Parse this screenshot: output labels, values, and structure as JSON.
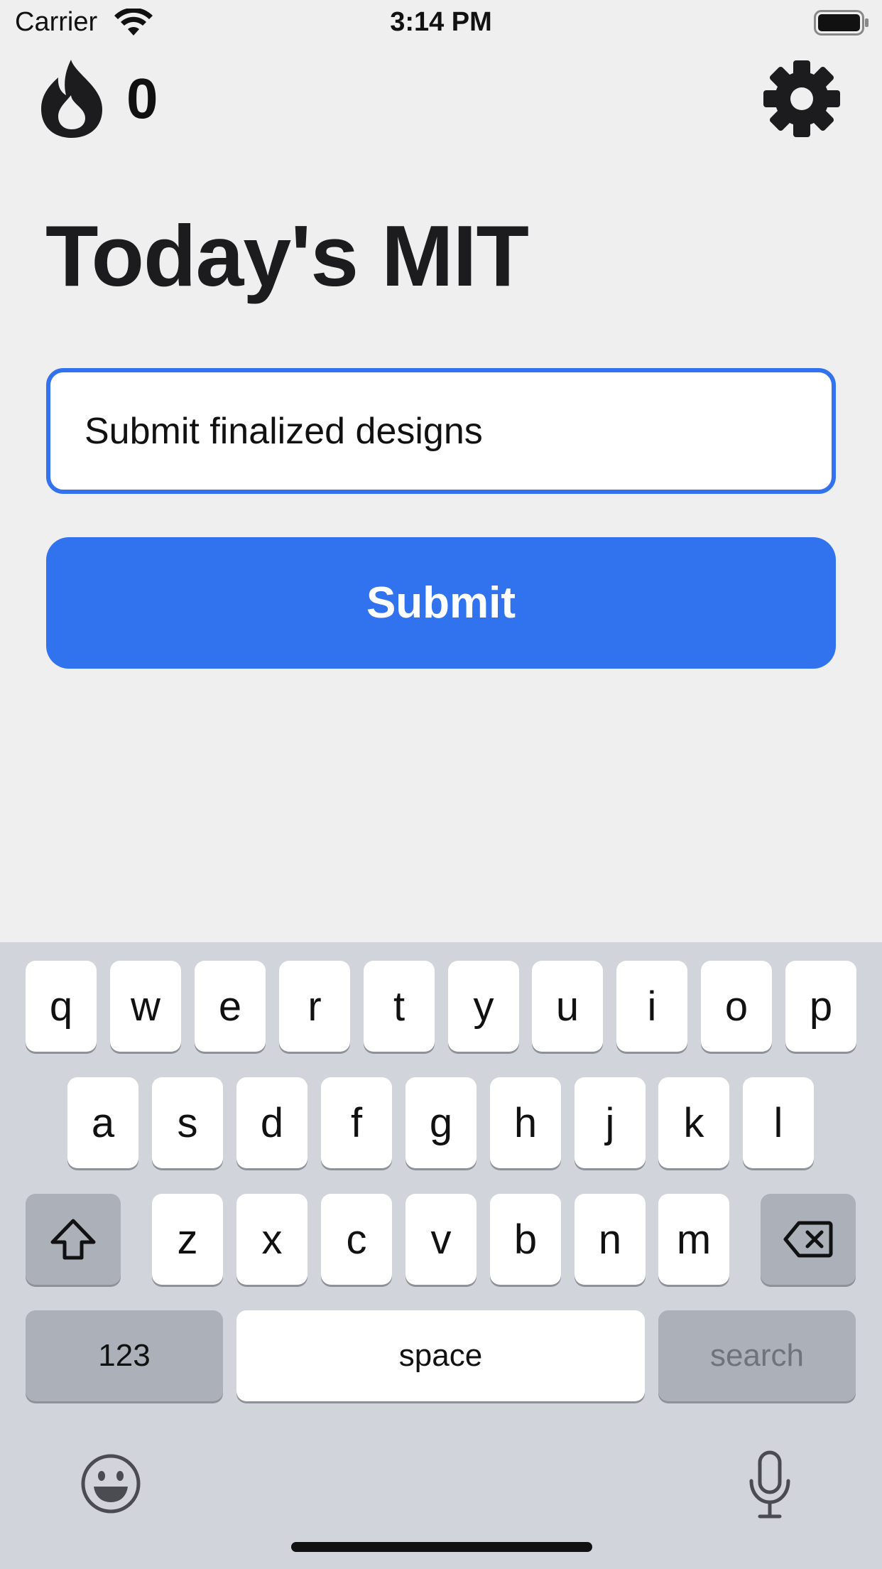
{
  "status_bar": {
    "carrier": "Carrier",
    "time": "3:14 PM",
    "wifi_icon": "wifi-icon",
    "battery_icon": "battery-icon"
  },
  "header": {
    "streak_icon": "flame-icon",
    "streak_count": "0",
    "settings_icon": "gear-icon"
  },
  "main": {
    "title": "Today's MIT",
    "mit_input": {
      "value": "Submit finalized designs",
      "placeholder": ""
    },
    "submit_label": "Submit"
  },
  "keyboard": {
    "row1": [
      "q",
      "w",
      "e",
      "r",
      "t",
      "y",
      "u",
      "i",
      "o",
      "p"
    ],
    "row2": [
      "a",
      "s",
      "d",
      "f",
      "g",
      "h",
      "j",
      "k",
      "l"
    ],
    "row3": [
      "z",
      "x",
      "c",
      "v",
      "b",
      "n",
      "m"
    ],
    "numbers_label": "123",
    "space_label": "space",
    "return_label": "search",
    "icons": [
      "shift-icon",
      "delete-icon",
      "emoji-icon",
      "microphone-icon"
    ]
  },
  "colors": {
    "accent": "#3172ef",
    "background": "#efefef",
    "keyboard_bg": "#d1d4da"
  }
}
